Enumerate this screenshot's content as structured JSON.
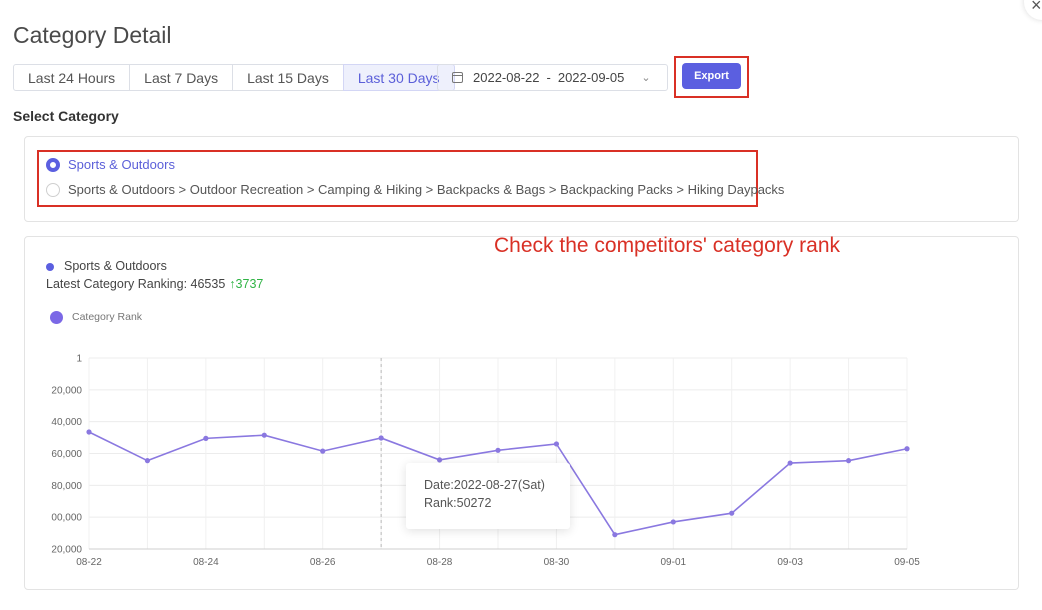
{
  "header": {
    "title": "Category Detail"
  },
  "close_icon": "×",
  "time_ranges": [
    {
      "label": "Last 24 Hours",
      "active": false
    },
    {
      "label": "Last 7 Days",
      "active": false
    },
    {
      "label": "Last 15 Days",
      "active": false
    },
    {
      "label": "Last 30 Days",
      "active": true
    }
  ],
  "date_range": {
    "from": "2022-08-22",
    "separator": "-",
    "to": "2022-09-05"
  },
  "export": {
    "label": "Export"
  },
  "select_category": {
    "label": "Select Category",
    "options": [
      {
        "label": "Sports & Outdoors",
        "selected": true
      },
      {
        "label": "Sports & Outdoors > Outdoor Recreation > Camping & Hiking > Backpacks & Bags > Backpacking Packs > Hiking Daypacks",
        "selected": false
      }
    ]
  },
  "annotation": "Check the competitors' category rank",
  "chart_panel": {
    "series_label": "Sports & Outdoors",
    "latest_text": "Latest Category Ranking: 46535",
    "change_text": "↑3737"
  },
  "colors": {
    "accent": "#5b5fe0",
    "line": "#8a78e0",
    "highlight": "#d93025",
    "up": "#2fb344"
  },
  "chart_data": {
    "type": "line",
    "legend": "Category Rank",
    "legend_position": "top-left",
    "y_inverted": true,
    "ylim": [
      1,
      120000
    ],
    "y_ticks": [
      {
        "value": 1,
        "label": "1"
      },
      {
        "value": 20000,
        "label": "20,000"
      },
      {
        "value": 40000,
        "label": "40,000"
      },
      {
        "value": 60000,
        "label": "60,000"
      },
      {
        "value": 80000,
        "label": "80,000"
      },
      {
        "value": 100000,
        "label": "00,000"
      },
      {
        "value": 120000,
        "label": "20,000"
      }
    ],
    "x": [
      "08-22",
      "08-23",
      "08-24",
      "08-25",
      "08-26",
      "08-27",
      "08-28",
      "08-29",
      "08-30",
      "08-31",
      "09-01",
      "09-02",
      "09-03",
      "09-04",
      "09-05"
    ],
    "x_tick_labels": [
      "08-22",
      "08-24",
      "08-26",
      "08-28",
      "08-30",
      "09-01",
      "09-03",
      "09-05"
    ],
    "series": [
      {
        "name": "Category Rank",
        "values": [
          46500,
          64500,
          50500,
          48500,
          58500,
          50272,
          64000,
          58000,
          54000,
          111000,
          103000,
          97500,
          66000,
          64500,
          57000
        ]
      }
    ],
    "grid": true,
    "tooltip": {
      "index": 5,
      "date_line": "Date:2022-08-27(Sat)",
      "rank_line": "Rank:50272"
    }
  }
}
